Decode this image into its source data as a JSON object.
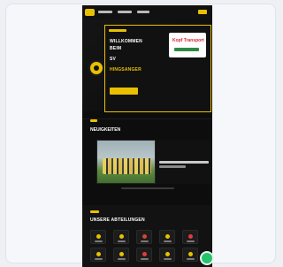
{
  "hero": {
    "title_lines": [
      "WILLKOMMEN",
      "BEIM",
      "SV",
      "HINGSANGER"
    ]
  },
  "sponsor": {
    "name": "Kopf Transport"
  },
  "sections": {
    "news_title": "NEUIGKEITEN",
    "quick_title": "UNSERE ABTEILUNGEN"
  },
  "tiles": [
    {
      "color": "#e9c000"
    },
    {
      "color": "#e9c000"
    },
    {
      "color": "#d6452e"
    },
    {
      "color": "#e9c000"
    },
    {
      "color": "#e23b3b"
    },
    {
      "color": "#e9c000"
    },
    {
      "color": "#e9c000"
    },
    {
      "color": "#e23b3b"
    },
    {
      "color": "#e9c000"
    },
    {
      "color": "#e9c000"
    }
  ]
}
